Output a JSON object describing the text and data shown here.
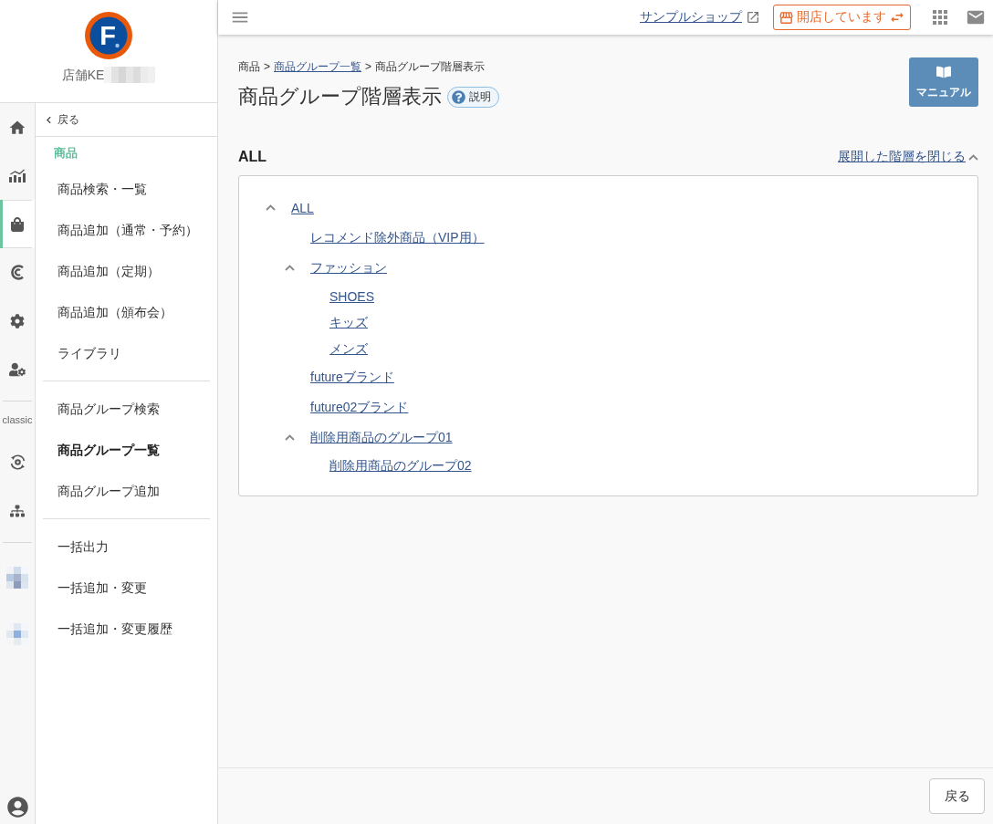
{
  "sidebar": {
    "logo": {
      "letter": "F"
    },
    "store_name": "店舗KE",
    "rail": {
      "main_items": [
        {
          "selected": false
        },
        {
          "selected": false
        },
        {
          "selected": true
        },
        {
          "selected": false
        },
        {
          "selected": false
        },
        {
          "selected": false
        }
      ],
      "classic_label": "classic",
      "classic_items": [
        {
          "selected": false
        },
        {
          "selected": false
        }
      ],
      "extra_items": [
        {
          "selected": false
        },
        {
          "selected": false
        }
      ]
    },
    "submenu": {
      "back": "戻る",
      "heading": "商品",
      "groups": [
        {
          "items": [
            {
              "label": "商品検索・一覧",
              "selected": false
            },
            {
              "label": "商品追加（通常・予約）",
              "selected": false
            },
            {
              "label": "商品追加（定期）",
              "selected": false
            },
            {
              "label": "商品追加（頒布会）",
              "selected": false
            },
            {
              "label": "ライブラリ",
              "selected": false
            }
          ]
        },
        {
          "items": [
            {
              "label": "商品グループ検索",
              "selected": false
            },
            {
              "label": "商品グループ一覧",
              "selected": true
            },
            {
              "label": "商品グループ追加",
              "selected": false
            }
          ]
        },
        {
          "items": [
            {
              "label": "一括出力",
              "selected": false
            },
            {
              "label": "一括追加・変更",
              "selected": false
            },
            {
              "label": "一括追加・変更履歴",
              "selected": false
            }
          ]
        }
      ]
    }
  },
  "topbar": {
    "shop_link": "サンプルショップ",
    "status_button": "開店しています"
  },
  "page": {
    "breadcrumb": [
      {
        "kind": "text",
        "label": "商品"
      },
      {
        "kind": "separator",
        "label": ">"
      },
      {
        "kind": "link",
        "label": "商品グループ一覧"
      },
      {
        "kind": "separator",
        "label": ">"
      },
      {
        "kind": "text",
        "label": "商品グループ階層表示"
      }
    ],
    "title": "商品グループ階層表示",
    "help_badge": "説明",
    "manual_button": "マニュアル"
  },
  "section": {
    "title": "ALL",
    "collapse_link": "展開した階層を閉じる"
  },
  "tree": [
    {
      "label": "ALL",
      "expanded": true,
      "children": [
        {
          "label": "レコメンド除外商品（VIP用）"
        },
        {
          "label": "ファッション",
          "expanded": true,
          "children": [
            {
              "label": "SHOES"
            },
            {
              "label": "キッズ"
            },
            {
              "label": "メンズ"
            }
          ]
        },
        {
          "label": "futureブランド"
        },
        {
          "label": "future02ブランド"
        },
        {
          "label": "削除用商品のグループ01",
          "expanded": true,
          "children": [
            {
              "label": "削除用商品のグループ02"
            }
          ]
        }
      ]
    }
  ],
  "footer": {
    "back_button": "戻る"
  }
}
